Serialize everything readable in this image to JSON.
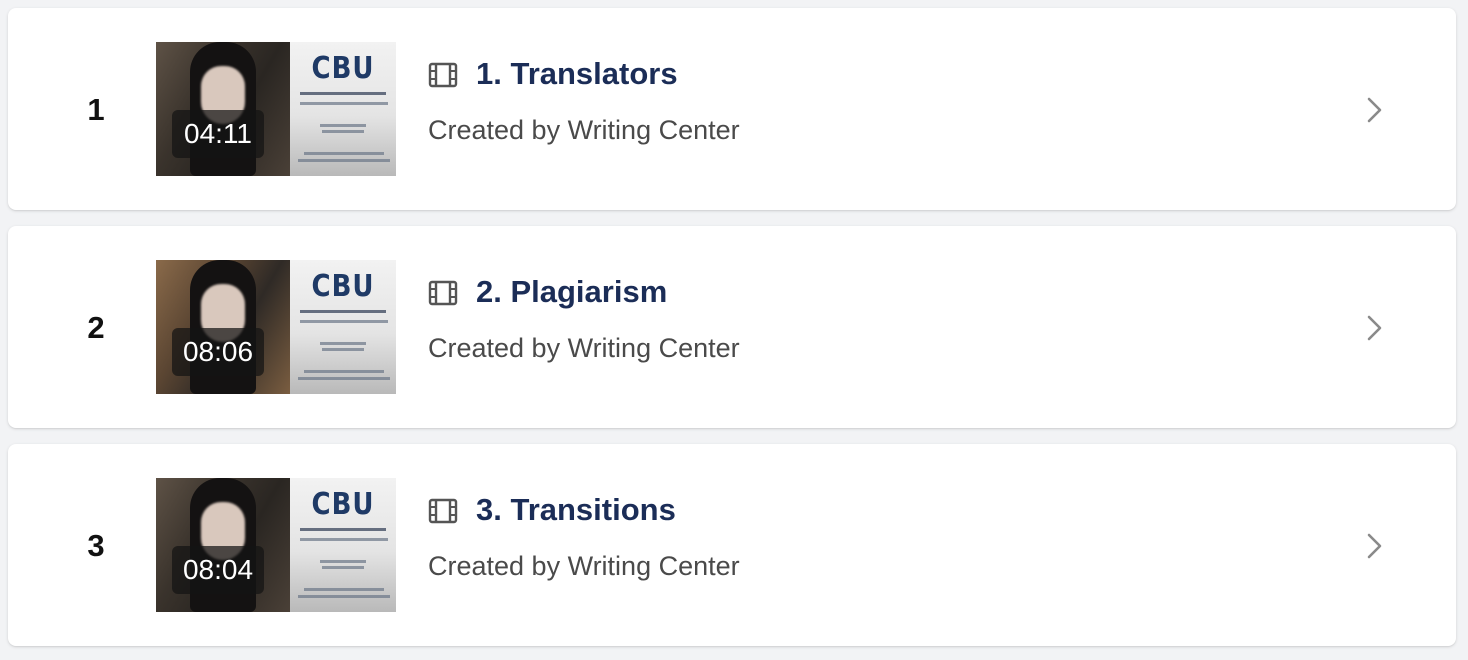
{
  "items": [
    {
      "index": "1",
      "duration": "04:11",
      "title": "1. Translators",
      "creator": "Created by Writing Center",
      "thumbnail_logo": "CBU"
    },
    {
      "index": "2",
      "duration": "08:06",
      "title": "2. Plagiarism",
      "creator": "Created by Writing Center",
      "thumbnail_logo": "CBU"
    },
    {
      "index": "3",
      "duration": "08:04",
      "title": "3. Transitions",
      "creator": "Created by Writing Center",
      "thumbnail_logo": "CBU"
    }
  ],
  "icons": {
    "media_type": "film-icon",
    "open": "chevron-right-icon"
  },
  "colors": {
    "background": "#f2f3f5",
    "card": "#ffffff",
    "title": "#1b2d57",
    "creator": "#4a4a4a",
    "chevron": "#8a8a8a"
  }
}
